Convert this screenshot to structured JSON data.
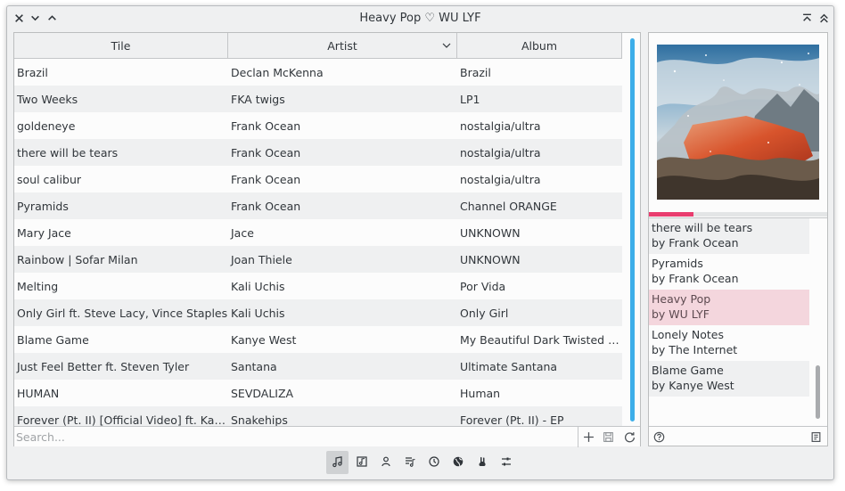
{
  "window": {
    "title": "Heavy Pop ♡ WU LYF"
  },
  "titlebar": {
    "left_buttons": [
      "close-icon",
      "minimize-icon",
      "maximize-icon"
    ],
    "right_buttons": [
      "keep-above-icon",
      "keep-above-double-icon"
    ]
  },
  "playlist": {
    "columns": [
      {
        "label": "Tile"
      },
      {
        "label": "Artist",
        "sorted": "descending"
      },
      {
        "label": "Album"
      }
    ],
    "rows": [
      {
        "title": "Brazil",
        "artist": "Declan McKenna",
        "album": "Brazil"
      },
      {
        "title": "Two Weeks",
        "artist": "FKA twigs",
        "album": "LP1"
      },
      {
        "title": "goldeneye",
        "artist": "Frank Ocean",
        "album": "nostalgia/ultra"
      },
      {
        "title": "there will be tears",
        "artist": "Frank Ocean",
        "album": "nostalgia/ultra"
      },
      {
        "title": "soul calibur",
        "artist": "Frank Ocean",
        "album": "nostalgia/ultra"
      },
      {
        "title": "Pyramids",
        "artist": "Frank Ocean",
        "album": "Channel ORANGE"
      },
      {
        "title": "Mary Jace",
        "artist": "Jace",
        "album": "UNKNOWN"
      },
      {
        "title": "Rainbow | Sofar Milan",
        "artist": "Joan Thiele",
        "album": "UNKNOWN"
      },
      {
        "title": "Melting",
        "artist": "Kali Uchis",
        "album": "Por Vida"
      },
      {
        "title": "Only Girl ft. Steve Lacy, Vince Staples",
        "artist": "Kali Uchis",
        "album": "Only Girl"
      },
      {
        "title": "Blame Game",
        "artist": "Kanye West",
        "album": "My Beautiful Dark Twisted Fa..."
      },
      {
        "title": "Just Feel Better ft. Steven Tyler",
        "artist": "Santana",
        "album": "Ultimate Santana"
      },
      {
        "title": "HUMAN",
        "artist": "SEVDALIZA",
        "album": "Human"
      },
      {
        "title": "Forever (Pt. II) [Official Video] ft. Kaleem...",
        "artist": "Snakehips",
        "album": "Forever (Pt. II) - EP"
      }
    ],
    "search": {
      "placeholder": "Search...",
      "value": ""
    },
    "footer_buttons": [
      "add-icon",
      "save-playlist-icon",
      "refresh-icon"
    ]
  },
  "now_playing": {
    "progress": 0.25,
    "queue": [
      {
        "line1": "there will be tears",
        "line2": "by Frank Ocean"
      },
      {
        "line1": "Pyramids",
        "line2": "by Frank Ocean"
      },
      {
        "line1": "Heavy Pop",
        "line2": "by WU LYF",
        "current": true
      },
      {
        "line1": "Lonely Notes",
        "line2": "by The Internet"
      },
      {
        "line1": "Blame Game",
        "line2": "by Kanye West"
      }
    ],
    "footer_buttons": [
      "help-icon",
      "notes-icon"
    ]
  },
  "tabs": [
    {
      "icon": "music-note-icon",
      "active": true
    },
    {
      "icon": "album-icon"
    },
    {
      "icon": "artist-icon"
    },
    {
      "icon": "playlist-icon"
    },
    {
      "icon": "history-icon"
    },
    {
      "icon": "globe-icon"
    },
    {
      "icon": "rabbit-icon"
    },
    {
      "icon": "settings-sliders-icon"
    }
  ],
  "colors": {
    "accent": "#3daee9",
    "progress": "#e93d6f",
    "current_track_bg": "#f4d6dd"
  }
}
